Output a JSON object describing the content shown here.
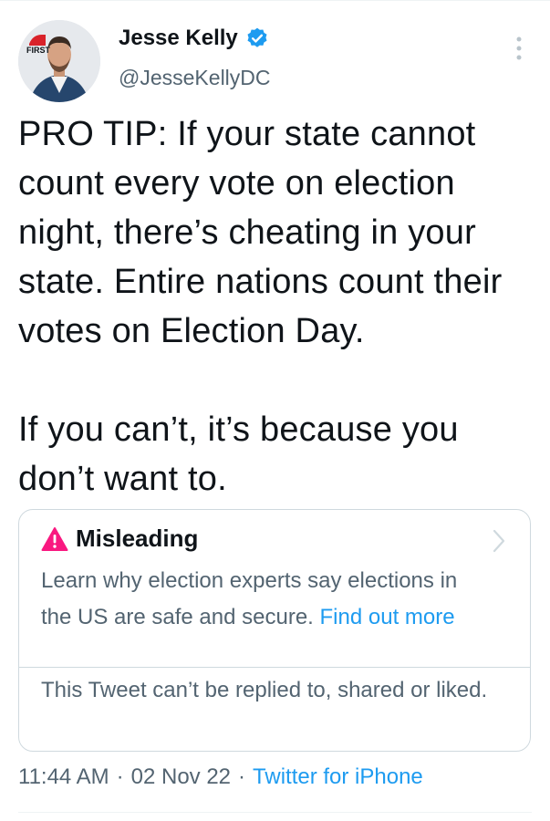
{
  "author": {
    "name": "Jesse Kelly",
    "handle": "@JesseKellyDC",
    "avatar_badge_text": "THE FIRST"
  },
  "tweet": {
    "text": "PRO TIP: If your state cannot count every vote on election night, there’s cheating in your state. Entire nations count their votes on Election Day.\n\nIf you can’t, it’s because you don’t want to."
  },
  "warning": {
    "title": "Misleading",
    "body": "Learn why election experts say elections in the US are safe and secure.",
    "link": "Find out more",
    "notice": "This Tweet can’t be replied to, shared or liked."
  },
  "meta": {
    "time": "11:44 AM",
    "separator": "·",
    "date": "02 Nov 22",
    "source": "Twitter for iPhone"
  },
  "colors": {
    "accent": "#1d9bf0",
    "warning": "#f91880",
    "secondary_text": "#536471"
  }
}
